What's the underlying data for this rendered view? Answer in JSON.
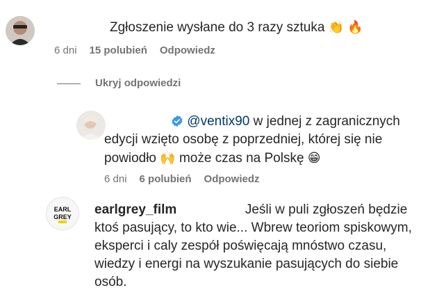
{
  "comment1": {
    "text": "Zgłoszenie wysłane do 3 razy sztuka",
    "emojis": "👏 🔥",
    "time": "6 dni",
    "likes": "15 polubień",
    "reply": "Odpowiedz"
  },
  "hide_replies": "Ukryj odpowiedzi",
  "reply1": {
    "mention": "@ventix90",
    "line1_rest": " w jednej z zagranicznych",
    "line2": "edycji wzięto osobę z poprzedniej, której się nie",
    "line3_a": "powiodło",
    "line3_emoji1": "🙌",
    "line3_b": "może czas na Polskę",
    "line3_emoji2": "😁",
    "time": "6 dni",
    "likes": "6 polubień",
    "reply": "Odpowiedz"
  },
  "comment2": {
    "username": "earlgrey_film",
    "avatar_text": "EARL GREY",
    "line1": "Jeśli w puli zgłoszeń będzie",
    "line2": "ktoś pasujący, to kto wie... Wbrew teoriom spiskowym,",
    "line3": "eksperci i caly zespół poświęcają mnóstwo czasu,",
    "line4": "wiedzy i energi na wyszukanie pasujących do siebie",
    "line5": "osób."
  },
  "colors": {
    "verified": "#3897f0",
    "mention": "#00376b",
    "meta": "#737373"
  }
}
